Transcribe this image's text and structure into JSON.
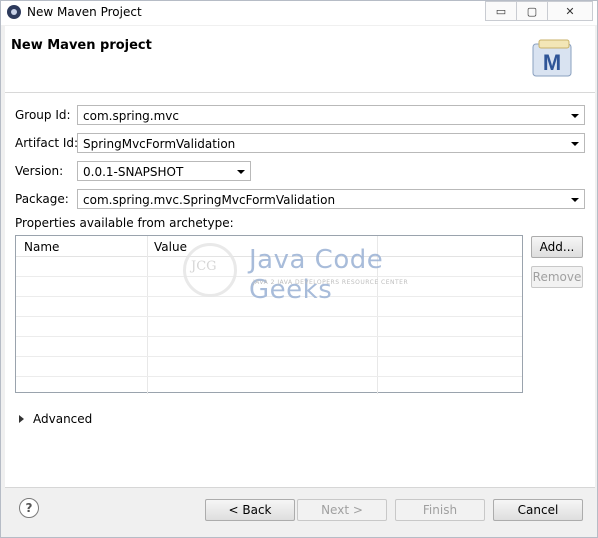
{
  "window": {
    "title": "New Maven Project",
    "controls": {
      "minimize": "▭",
      "maximize": "▢",
      "close": "✕"
    }
  },
  "header": {
    "title": "New Maven project",
    "logo_letter": "M"
  },
  "form": {
    "group_id": {
      "label": "Group Id:",
      "value": "com.spring.mvc"
    },
    "artifact_id": {
      "label": "Artifact Id:",
      "value": "SpringMvcFormValidation"
    },
    "version": {
      "label": "Version:",
      "value": "0.0.1-SNAPSHOT"
    },
    "package": {
      "label": "Package:",
      "value": "com.spring.mvc.SpringMvcFormValidation"
    }
  },
  "properties": {
    "label": "Properties available from archetype:",
    "columns": [
      "Name",
      "Value"
    ],
    "rows": [],
    "add_button": "Add...",
    "remove_button": "Remove"
  },
  "watermark": {
    "logo_text": "JCG",
    "title": "Java Code Geeks",
    "subtitle": "JAVA 2 JAVA DEVELOPERS RESOURCE CENTER"
  },
  "advanced": {
    "label": "Advanced"
  },
  "footer": {
    "help_icon": "?",
    "back": "< Back",
    "next": "Next >",
    "finish": "Finish",
    "cancel": "Cancel"
  },
  "colors": {
    "accent": "#9fb5d6",
    "logo_bg": "#d9e3f1",
    "logo_letter": "#2f5597"
  }
}
